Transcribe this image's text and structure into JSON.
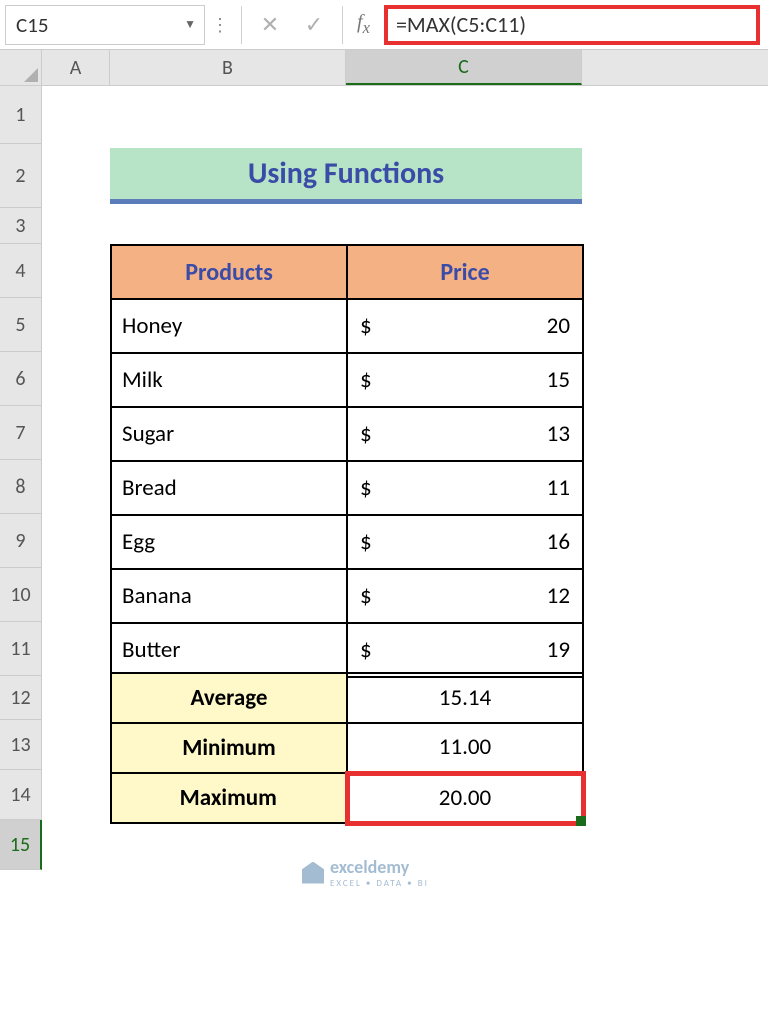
{
  "nameBox": "C15",
  "formula": "=MAX(C5:C11)",
  "columns": {
    "A": "A",
    "B": "B",
    "C": "C"
  },
  "rows": [
    "1",
    "2",
    "3",
    "4",
    "5",
    "6",
    "7",
    "8",
    "9",
    "10",
    "11",
    "12",
    "13",
    "14",
    "15"
  ],
  "title": "Using Functions",
  "headers": {
    "products": "Products",
    "price": "Price"
  },
  "currency": "$",
  "products": [
    {
      "name": "Honey",
      "price": "20"
    },
    {
      "name": "Milk",
      "price": "15"
    },
    {
      "name": "Sugar",
      "price": "13"
    },
    {
      "name": "Bread",
      "price": "11"
    },
    {
      "name": "Egg",
      "price": "16"
    },
    {
      "name": "Banana",
      "price": "12"
    },
    {
      "name": "Butter",
      "price": "19"
    }
  ],
  "stats": {
    "average": {
      "label": "Average",
      "value": "15.14"
    },
    "minimum": {
      "label": "Minimum",
      "value": "11.00"
    },
    "maximum": {
      "label": "Maximum",
      "value": "20.00"
    }
  },
  "watermark": {
    "brand": "exceldemy",
    "tagline": "EXCEL • DATA • BI"
  }
}
